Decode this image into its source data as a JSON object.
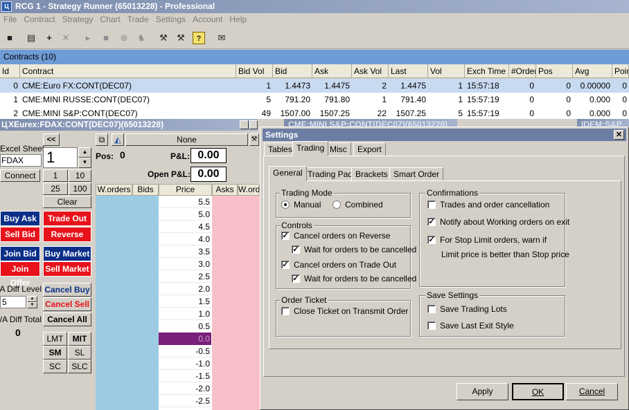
{
  "app": {
    "title": "RCG 1 - Strategy Runner (65013228) - Professional"
  },
  "menu": [
    "File",
    "Contract",
    "Strategy",
    "Chart",
    "Trade",
    "Settings",
    "Account",
    "Help"
  ],
  "contracts": {
    "header": "Contracts (10)",
    "columns": [
      "Id",
      "Contract",
      "Bid Vol",
      "Bid",
      "Ask",
      "Ask Vol",
      "Last",
      "Vol",
      "Exch Time",
      "#Orders",
      "Pos",
      "Avg",
      "Points"
    ],
    "rows": [
      [
        "0",
        "CME:Euro FX:CONT(DEC07)",
        "1",
        "1.4473",
        "1.4475",
        "2",
        "1.4475",
        "1",
        "15:57:18",
        "0",
        "0",
        "0.00000",
        "0"
      ],
      [
        "1",
        "CME:MINI RUSSE:CONT(DEC07)",
        "5",
        "791.20",
        "791.80",
        "1",
        "791.40",
        "1",
        "15:57:19",
        "0",
        "0",
        "0.000",
        "0"
      ],
      [
        "2",
        "CME:MINI S&P:CONT(DEC07)",
        "49",
        "1507.00",
        "1507.25",
        "22",
        "1507.25",
        "5",
        "15:57:19",
        "0",
        "0",
        "0.000",
        "0"
      ]
    ]
  },
  "dom": {
    "title": "XEurex:FDAX:CONT(DEC07)(65013228)",
    "nav_back": "<<",
    "none_label": "None",
    "excel_sheet_label": "Excel Sheet",
    "excel_sheet_value": "FDAX",
    "qty": "1",
    "connect": "Connect",
    "qty_btns": [
      "1",
      "10",
      "25",
      "100"
    ],
    "clear": "Clear",
    "pos_label": "Pos:",
    "pos_value": "0",
    "pl_label": "P&L:",
    "pl_value": "0.00",
    "open_pl_label": "Open P&L:",
    "open_pl_value": "0.00",
    "buy_ask": "Buy Ask",
    "trade_out": "Trade Out",
    "sell_bid": "Sell Bid",
    "reverse": "Reverse",
    "join_bid": "Join Bid",
    "buy_market": "Buy Market",
    "join_offer": "Join Offer",
    "sell_market": "Sell Market",
    "diff_level_label": "B/A Diff Level",
    "diff_level_value": "5",
    "diff_total_label": "B/A Diff Total",
    "diff_total_value": "0",
    "cancel_buy": "Cancel Buy",
    "cancel_sell": "Cancel Sell",
    "cancel_all": "Cancel All",
    "order_types": [
      "LMT",
      "MIT",
      "SM",
      "SL",
      "SC",
      "SLC"
    ],
    "ladder_headers": [
      "W.orders",
      "Bids",
      "Price",
      "Asks",
      "W.orde"
    ],
    "prices": [
      "5.5",
      "5.0",
      "4.5",
      "4.0",
      "3.5",
      "3.0",
      "2.5",
      "2.0",
      "1.5",
      "1.0",
      "0.5",
      "0.0",
      "-0.5",
      "-1.0",
      "-1.5",
      "-2.0",
      "-2.5"
    ],
    "highlight_price": "0.0"
  },
  "background_windows": [
    "CME:MINI S&P:CONT(DEC07)(65013228)",
    "IDEM:S&P"
  ],
  "settings": {
    "title": "Settings",
    "close": "✕",
    "tabs": [
      "Tables",
      "Trading",
      "Misc",
      "Export"
    ],
    "active_tab": "Trading",
    "subtabs": [
      "General",
      "Trading Pad",
      "Brackets",
      "Smart Order"
    ],
    "active_subtab": "General",
    "trading_mode": {
      "label": "Trading Mode",
      "options": [
        "Manual",
        "Combined"
      ],
      "selected": "Manual"
    },
    "controls": {
      "label": "Controls",
      "items": [
        {
          "text": "Cancel orders on Reverse",
          "checked": true
        },
        {
          "text": "Wait for orders to be cancelled",
          "checked": true
        },
        {
          "text": "Cancel orders on Trade Out",
          "checked": true
        },
        {
          "text": "Wait for orders to be cancelled",
          "checked": true
        }
      ]
    },
    "order_ticket": {
      "label": "Order Ticket",
      "items": [
        {
          "text": "Close Ticket on Transmit Order",
          "checked": false
        }
      ]
    },
    "confirmations": {
      "label": "Confirmations",
      "items": [
        {
          "text": "Trades and order cancellation",
          "checked": false
        },
        {
          "text": "Notify about Working orders on exit",
          "checked": true
        },
        {
          "text": "For Stop Limit orders, warn if",
          "checked": true
        }
      ],
      "note": "Limit price is better than Stop price"
    },
    "save_settings": {
      "label": "Save Settings",
      "items": [
        {
          "text": "Save Trading Lots",
          "checked": false
        },
        {
          "text": "Save Last Exit Style",
          "checked": false
        }
      ]
    },
    "buttons": {
      "apply": "Apply",
      "ok": "OK",
      "cancel": "Cancel"
    }
  }
}
